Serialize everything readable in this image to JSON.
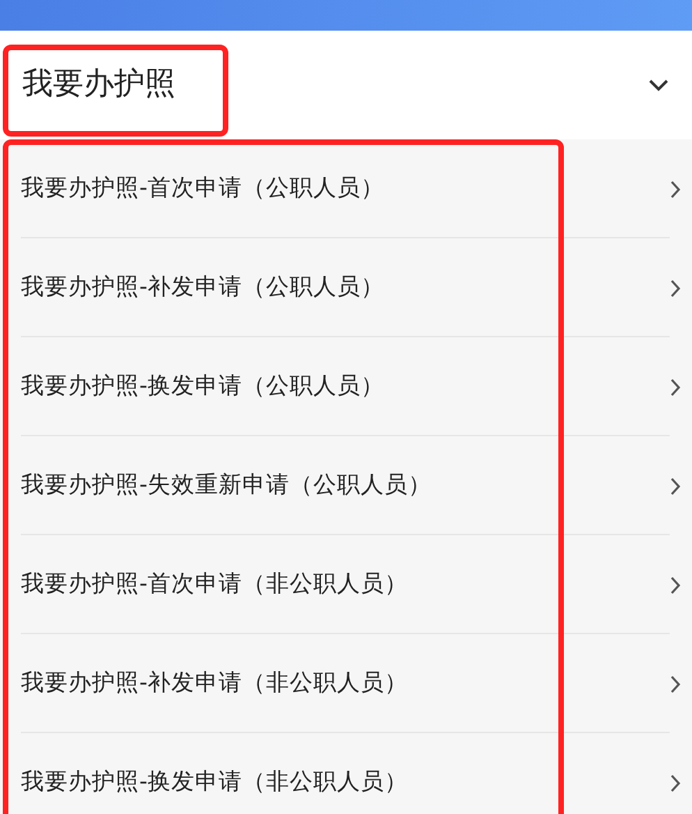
{
  "section": {
    "title": "我要办护照",
    "expanded": true,
    "highlighted": true
  },
  "items_highlighted": true,
  "items": [
    {
      "label": "我要办护照-首次申请（公职人员）"
    },
    {
      "label": "我要办护照-补发申请（公职人员）"
    },
    {
      "label": "我要办护照-换发申请（公职人员）"
    },
    {
      "label": "我要办护照-失效重新申请（公职人员）"
    },
    {
      "label": "我要办护照-首次申请（非公职人员）"
    },
    {
      "label": "我要办护照-补发申请（非公职人员）"
    },
    {
      "label": "我要办护照-换发申请（非公职人员）"
    }
  ]
}
